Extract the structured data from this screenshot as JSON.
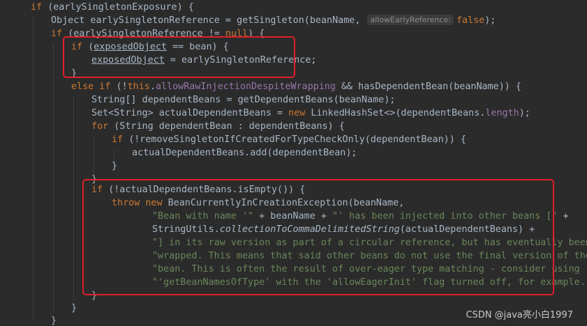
{
  "code": {
    "lines": [
      [
        {
          "t": "if ",
          "c": "kw"
        },
        {
          "t": "(earlySingletonExposure) {"
        }
      ],
      [
        {
          "t": "Object earlySingletonReference = getSingleton(beanName, "
        },
        {
          "t": "allowEarlyReference:",
          "c": "hint"
        },
        {
          "t": "false",
          "c": "kw"
        },
        {
          "t": ");"
        }
      ],
      [
        {
          "t": "if ",
          "c": "kw"
        },
        {
          "t": "(earlySingletonReference != "
        },
        {
          "t": "null",
          "c": "kw"
        },
        {
          "t": ") {"
        }
      ],
      [
        {
          "t": "if ",
          "c": "kw"
        },
        {
          "t": "("
        },
        {
          "t": "exposedObject",
          "c": "under"
        },
        {
          "t": " == bean) {"
        }
      ],
      [
        {
          "t": "exposedObject",
          "c": "under"
        },
        {
          "t": " = earlySingletonReference;"
        }
      ],
      [
        {
          "t": "}"
        }
      ],
      [
        {
          "t": "else if ",
          "c": "kw"
        },
        {
          "t": "(!"
        },
        {
          "t": "this",
          "c": "kw"
        },
        {
          "t": "."
        },
        {
          "t": "allowRawInjectionDespiteWrapping",
          "c": "fld"
        },
        {
          "t": " && hasDependentBean(beanName)) {"
        }
      ],
      [
        {
          "t": "String[] dependentBeans = getDependentBeans(beanName);"
        }
      ],
      [
        {
          "t": "Set<String> actualDependentBeans = "
        },
        {
          "t": "new ",
          "c": "kw"
        },
        {
          "t": "LinkedHashSet<>(dependentBeans."
        },
        {
          "t": "length",
          "c": "fld"
        },
        {
          "t": ");"
        }
      ],
      [
        {
          "t": "for ",
          "c": "kw"
        },
        {
          "t": "(String dependentBean : dependentBeans) {"
        }
      ],
      [
        {
          "t": "if ",
          "c": "kw"
        },
        {
          "t": "(!removeSingletonIfCreatedForTypeCheckOnly(dependentBean)) {"
        }
      ],
      [
        {
          "t": "actualDependentBeans.add(dependentBean);"
        }
      ],
      [
        {
          "t": "}"
        }
      ],
      [
        {
          "t": "}"
        }
      ],
      [
        {
          "t": "if ",
          "c": "kw"
        },
        {
          "t": "(!actualDependentBeans.isEmpty()) {"
        }
      ],
      [
        {
          "t": "throw new ",
          "c": "kw"
        },
        {
          "t": "BeanCurrentlyInCreationException(beanName,"
        }
      ],
      [
        {
          "t": "\"Bean with name '\"",
          "c": "str"
        },
        {
          "t": " + beanName + "
        },
        {
          "t": "\"' has been injected into other beans [\"",
          "c": "str"
        },
        {
          "t": " +"
        }
      ],
      [
        {
          "t": "StringUtils."
        },
        {
          "t": "collectionToCommaDelimitedString",
          "c": "ital"
        },
        {
          "t": "(actualDependentBeans) +"
        }
      ],
      [
        {
          "t": "\"] in its raw version as part of a circular reference, but has eventually been \"",
          "c": "str"
        },
        {
          "t": " +"
        }
      ],
      [
        {
          "t": "\"wrapped. This means that said other beans do not use the final version of the \"",
          "c": "str"
        },
        {
          "t": " +"
        }
      ],
      [
        {
          "t": "\"bean. This is often the result of over-eager type matching - consider using \"",
          "c": "str"
        },
        {
          "t": " +"
        }
      ],
      [
        {
          "t": "\"'getBeanNamesOfType' with the 'allowEagerInit' flag turned off, for example.\"",
          "c": "str"
        },
        {
          "t": ");"
        }
      ],
      [
        {
          "t": "}"
        }
      ],
      [
        {
          "t": "}"
        }
      ],
      [
        {
          "t": "}"
        }
      ]
    ]
  },
  "watermark": "CSDN @java亮小白1997"
}
